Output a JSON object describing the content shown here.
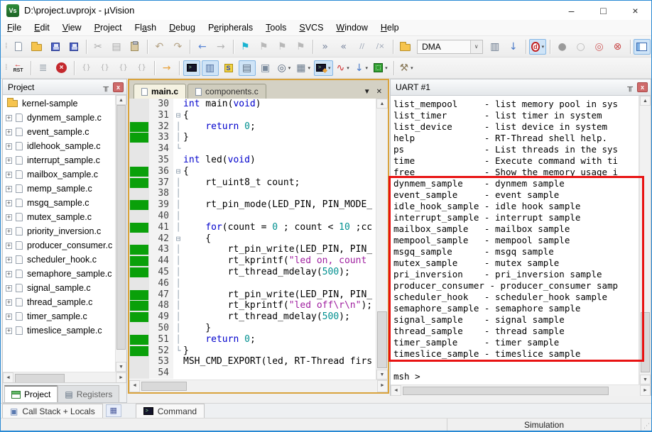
{
  "window": {
    "title": "D:\\project.uvprojx - µVision",
    "logo_text": "Vs",
    "controls": {
      "minimize": "–",
      "maximize": "□",
      "close": "×"
    }
  },
  "menu": {
    "items": [
      {
        "label": "File",
        "u": 0
      },
      {
        "label": "Edit",
        "u": 0
      },
      {
        "label": "View",
        "u": 0
      },
      {
        "label": "Project",
        "u": 0
      },
      {
        "label": "Flash",
        "u": 2
      },
      {
        "label": "Debug",
        "u": 0
      },
      {
        "label": "Peripherals",
        "u": 1
      },
      {
        "label": "Tools",
        "u": 0
      },
      {
        "label": "SVCS",
        "u": 0
      },
      {
        "label": "Window",
        "u": 0
      },
      {
        "label": "Help",
        "u": 0
      }
    ]
  },
  "toolbar_main": {
    "items": [
      {
        "t": "b",
        "n": "new-file-button",
        "k": "pagenew"
      },
      {
        "t": "b",
        "n": "open-file-button",
        "k": "folder"
      },
      {
        "t": "b",
        "n": "save-button",
        "k": "floppy"
      },
      {
        "t": "b",
        "n": "save-all-button",
        "k": "floppy floppy2"
      },
      {
        "t": "s"
      },
      {
        "t": "b",
        "n": "cut-button",
        "g": "✂",
        "c": "#aaaaaa"
      },
      {
        "t": "b",
        "n": "copy-button",
        "g": "▤",
        "c": "#aaaaaa"
      },
      {
        "t": "b",
        "n": "paste-button",
        "k": "paste"
      },
      {
        "t": "s"
      },
      {
        "t": "b",
        "n": "undo-button",
        "g": "↶",
        "c": "#b3a183"
      },
      {
        "t": "b",
        "n": "redo-button",
        "g": "↷",
        "c": "#b3a183"
      },
      {
        "t": "s"
      },
      {
        "t": "b",
        "n": "navigate-back-button",
        "g": "←",
        "c": "#5b87d6"
      },
      {
        "t": "b",
        "n": "navigate-forward-button",
        "g": "→",
        "c": "#b4b4b4"
      },
      {
        "t": "s"
      },
      {
        "t": "b",
        "n": "bookmark-toggle-button",
        "g": "⚑",
        "c": "#19b3d1"
      },
      {
        "t": "b",
        "n": "bookmark-next-button",
        "g": "⚑",
        "c": "#b8b8b8"
      },
      {
        "t": "b",
        "n": "bookmark-previous-button",
        "g": "⚑",
        "c": "#b8b8b8"
      },
      {
        "t": "b",
        "n": "bookmark-clear-all-button",
        "g": "⚑",
        "c": "#b8b8b8"
      },
      {
        "t": "s"
      },
      {
        "t": "b",
        "n": "indent-button",
        "g": "»",
        "c": "#7c88a0"
      },
      {
        "t": "b",
        "n": "outdent-button",
        "g": "«",
        "c": "#7c88a0"
      },
      {
        "t": "b",
        "n": "comment-button",
        "g": "//",
        "c": "#9aa4b4",
        "sm": true
      },
      {
        "t": "b",
        "n": "uncomment-button",
        "g": "/×",
        "c": "#9aa4b4",
        "sm": true
      },
      {
        "t": "s"
      },
      {
        "t": "b",
        "n": "configure-flash-tools-button",
        "k": "folder"
      },
      {
        "t": "combo",
        "n": "target-select-combo",
        "value": "DMA"
      },
      {
        "t": "b",
        "n": "find-in-files-button",
        "g": "▥",
        "c": "#68788c"
      },
      {
        "t": "b",
        "n": "find-next-button",
        "g": "↓",
        "c": "#4a7ac8"
      },
      {
        "t": "s"
      },
      {
        "t": "b",
        "n": "start-stop-debug-button",
        "k": "debug",
        "hl": true,
        "dd": true
      },
      {
        "t": "s"
      },
      {
        "t": "b",
        "n": "insert-breakpoint-button",
        "g": "●",
        "c": "#9a9a9a"
      },
      {
        "t": "b",
        "n": "enable-breakpoint-button",
        "g": "○",
        "c": "#b8b8b8"
      },
      {
        "t": "b",
        "n": "disable-all-breakpoints-button",
        "g": "◎",
        "c": "#d06060"
      },
      {
        "t": "b",
        "n": "kill-all-breakpoints-button",
        "g": "⊗",
        "c": "#c84848"
      },
      {
        "t": "s"
      },
      {
        "t": "b",
        "n": "project-window-button",
        "k": "panelwin",
        "hl": true
      }
    ]
  },
  "toolbar_debug": {
    "items": [
      {
        "t": "b",
        "n": "cpu-reset-button",
        "k": "rst"
      },
      {
        "t": "s"
      },
      {
        "t": "b",
        "n": "run-button",
        "g": "≣",
        "c": "#9aa4ae"
      },
      {
        "t": "b",
        "n": "stop-button",
        "k": "stop"
      },
      {
        "t": "s"
      },
      {
        "t": "b",
        "n": "step-into-button",
        "g": "{}",
        "c": "#b0b0b0",
        "sm": true
      },
      {
        "t": "b",
        "n": "step-over-button",
        "g": "{}",
        "c": "#b0b0b0",
        "sm": true
      },
      {
        "t": "b",
        "n": "step-out-button",
        "g": "{}",
        "c": "#b0b0b0",
        "sm": true
      },
      {
        "t": "b",
        "n": "run-to-cursor-button",
        "g": "{}",
        "c": "#b0b0b0",
        "sm": true
      },
      {
        "t": "s"
      },
      {
        "t": "b",
        "n": "show-next-statement-button",
        "g": "→",
        "c": "#e8a23c"
      },
      {
        "t": "s"
      },
      {
        "t": "b",
        "n": "command-window-button",
        "k": "console",
        "hl": true
      },
      {
        "t": "b",
        "n": "disassembly-window-button",
        "g": "▥",
        "c": "#4a6a9c",
        "hl": true
      },
      {
        "t": "b",
        "n": "symbol-window-button",
        "k": "symbol"
      },
      {
        "t": "b",
        "n": "registers-window-button",
        "g": "▤",
        "c": "#5a6a7c",
        "hl": true
      },
      {
        "t": "b",
        "n": "call-stack-window-button",
        "g": "▣",
        "c": "#7a8a9c"
      },
      {
        "t": "b",
        "n": "watch-window-button",
        "g": "◎",
        "c": "#55657a",
        "dd": true
      },
      {
        "t": "b",
        "n": "memory-window-button",
        "g": "▦",
        "c": "#6a7a8c",
        "dd": true
      },
      {
        "t": "b",
        "n": "serial-window-button",
        "k": "consolepen",
        "hl": true,
        "dd": true
      },
      {
        "t": "b",
        "n": "logic-analyzer-button",
        "g": "∿",
        "c": "#d03030",
        "dd": true
      },
      {
        "t": "b",
        "n": "trace-window-button",
        "g": "↓",
        "c": "#4a7ac8",
        "dd": true
      },
      {
        "t": "b",
        "n": "system-viewer-button",
        "k": "chip",
        "dd": true
      },
      {
        "t": "s"
      },
      {
        "t": "b",
        "n": "toolbox-button",
        "g": "⚒",
        "c": "#8a7a5a",
        "dd": true
      }
    ]
  },
  "project_panel": {
    "title": "Project",
    "root": "kernel-sample",
    "files": [
      "dynmem_sample.c",
      "event_sample.c",
      "idlehook_sample.c",
      "interrupt_sample.c",
      "mailbox_sample.c",
      "memp_sample.c",
      "msgq_sample.c",
      "mutex_sample.c",
      "priority_inversion.c",
      "producer_consumer.c",
      "scheduler_hook.c",
      "semaphore_sample.c",
      "signal_sample.c",
      "thread_sample.c",
      "timer_sample.c",
      "timeslice_sample.c"
    ],
    "tabs": [
      {
        "label": "Project"
      },
      {
        "label": "Registers"
      }
    ]
  },
  "editor": {
    "tabs": [
      "main.c",
      "components.c"
    ],
    "lines": [
      {
        "n": 30,
        "g": false,
        "f": "",
        "s": [
          [
            "k",
            "int"
          ],
          [
            "p",
            " main("
          ],
          [
            "k",
            "void"
          ],
          [
            "p",
            ")"
          ]
        ]
      },
      {
        "n": 31,
        "g": false,
        "f": "⊟",
        "s": [
          [
            "p",
            "{"
          ]
        ]
      },
      {
        "n": 32,
        "g": true,
        "f": "│",
        "s": [
          [
            "p",
            "    "
          ],
          [
            "k",
            "return"
          ],
          [
            "p",
            " "
          ],
          [
            "n",
            "0"
          ],
          [
            "p",
            ";"
          ]
        ]
      },
      {
        "n": 33,
        "g": true,
        "f": "│",
        "s": [
          [
            "p",
            "}"
          ]
        ]
      },
      {
        "n": 34,
        "g": false,
        "f": "└",
        "s": []
      },
      {
        "n": 35,
        "g": false,
        "f": "",
        "s": [
          [
            "k",
            "int"
          ],
          [
            "p",
            " led("
          ],
          [
            "k",
            "void"
          ],
          [
            "p",
            ")"
          ]
        ]
      },
      {
        "n": 36,
        "g": true,
        "f": "⊟",
        "s": [
          [
            "p",
            "{"
          ]
        ]
      },
      {
        "n": 37,
        "g": true,
        "f": "│",
        "s": [
          [
            "p",
            "    rt_uint8_t count;"
          ]
        ]
      },
      {
        "n": 38,
        "g": false,
        "f": "│",
        "s": []
      },
      {
        "n": 39,
        "g": true,
        "f": "│",
        "s": [
          [
            "p",
            "    rt_pin_mode(LED_PIN, PIN_MODE_"
          ]
        ]
      },
      {
        "n": 40,
        "g": false,
        "f": "│",
        "s": []
      },
      {
        "n": 41,
        "g": true,
        "f": "│",
        "s": [
          [
            "p",
            "    "
          ],
          [
            "k",
            "for"
          ],
          [
            "p",
            "(count = "
          ],
          [
            "n",
            "0"
          ],
          [
            "p",
            " ; count < "
          ],
          [
            "n",
            "10"
          ],
          [
            "p",
            " ;cc"
          ]
        ]
      },
      {
        "n": 42,
        "g": false,
        "f": "⊟",
        "s": [
          [
            "p",
            "    {"
          ]
        ]
      },
      {
        "n": 43,
        "g": true,
        "f": "│",
        "s": [
          [
            "p",
            "        rt_pin_write(LED_PIN, PIN_"
          ]
        ]
      },
      {
        "n": 44,
        "g": true,
        "f": "│",
        "s": [
          [
            "p",
            "        rt_kprintf("
          ],
          [
            "s",
            "\"led on, count"
          ]
        ]
      },
      {
        "n": 45,
        "g": true,
        "f": "│",
        "s": [
          [
            "p",
            "        rt_thread_mdelay("
          ],
          [
            "n",
            "500"
          ],
          [
            "p",
            ");"
          ]
        ]
      },
      {
        "n": 46,
        "g": false,
        "f": "│",
        "s": []
      },
      {
        "n": 47,
        "g": true,
        "f": "│",
        "s": [
          [
            "p",
            "        rt_pin_write(LED_PIN, PIN_"
          ]
        ]
      },
      {
        "n": 48,
        "g": true,
        "f": "│",
        "s": [
          [
            "p",
            "        rt_kprintf("
          ],
          [
            "s",
            "\"led off\\r\\n\""
          ],
          [
            "p",
            ");"
          ]
        ]
      },
      {
        "n": 49,
        "g": true,
        "f": "│",
        "s": [
          [
            "p",
            "        rt_thread_mdelay("
          ],
          [
            "n",
            "500"
          ],
          [
            "p",
            ");"
          ]
        ]
      },
      {
        "n": 50,
        "g": false,
        "f": "│",
        "s": [
          [
            "p",
            "    }"
          ]
        ]
      },
      {
        "n": 51,
        "g": true,
        "f": "│",
        "s": [
          [
            "p",
            "    "
          ],
          [
            "k",
            "return"
          ],
          [
            "p",
            " "
          ],
          [
            "n",
            "0"
          ],
          [
            "p",
            ";"
          ]
        ]
      },
      {
        "n": 52,
        "g": true,
        "f": "└",
        "s": [
          [
            "p",
            "}"
          ]
        ]
      },
      {
        "n": 53,
        "g": false,
        "f": "",
        "s": [
          [
            "p",
            "MSH_CMD_EXPORT(led, RT-Thread firs"
          ]
        ]
      },
      {
        "n": 54,
        "g": false,
        "f": "",
        "s": []
      }
    ]
  },
  "uart": {
    "title": "UART #1",
    "lines": [
      "list_mempool     - list memory pool in sys",
      "list_timer       - list timer in system",
      "list_device      - list device in system",
      "help             - RT-Thread shell help.",
      "ps               - List threads in the sys",
      "time             - Execute command with ti",
      "free             - Show the memory usage i",
      "dynmem_sample    - dynmem sample",
      "event_sample     - event sample",
      "idle_hook_sample - idle hook sample",
      "interrupt_sample - interrupt sample",
      "mailbox_sample   - mailbox sample",
      "mempool_sample   - mempool sample",
      "msgq_sample      - msgq sample",
      "mutex_sample     - mutex sample",
      "pri_inversion    - pri_inversion sample",
      "producer_consumer - producer_consumer samp",
      "scheduler_hook   - scheduler_hook sample",
      "semaphore_sample - semaphore sample",
      "signal_sample    - signal sample",
      "thread_sample    - thread sample",
      "timer_sample     - timer sample",
      "timeslice_sample - timeslice sample",
      "",
      "msh >"
    ],
    "highlight_color": "#e81212"
  },
  "bottom_bars": {
    "call_stack_label": "Call Stack + Locals",
    "command_label": "Command"
  },
  "status": {
    "mode": "Simulation"
  }
}
